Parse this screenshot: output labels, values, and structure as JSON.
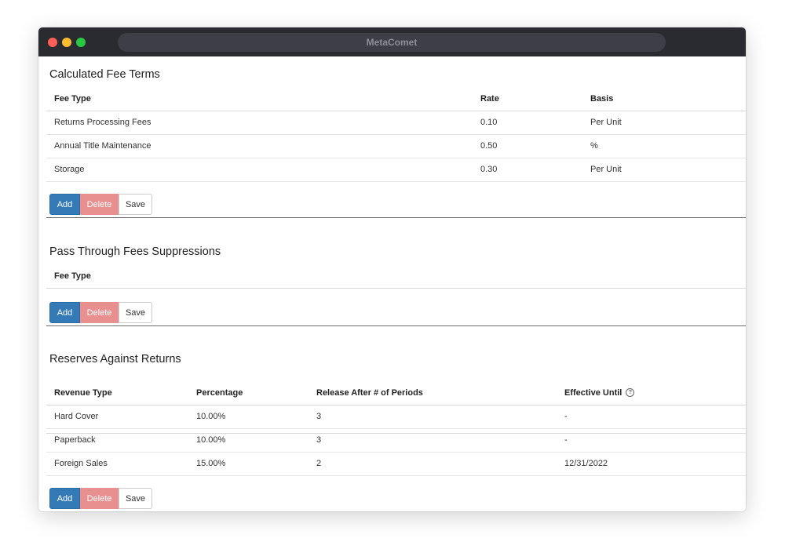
{
  "window": {
    "title": "MetaComet"
  },
  "buttons": {
    "add": "Add",
    "delete": "Delete",
    "save": "Save"
  },
  "calculated_fee_terms": {
    "title": "Calculated Fee Terms",
    "columns": [
      "Fee Type",
      "Rate",
      "Basis"
    ],
    "rows": [
      [
        "Returns Processing Fees",
        "0.10",
        "Per Unit"
      ],
      [
        "Annual Title Maintenance",
        "0.50",
        "%"
      ],
      [
        "Storage",
        "0.30",
        "Per Unit"
      ]
    ]
  },
  "pass_through": {
    "title": "Pass Through Fees Suppressions",
    "columns": [
      "Fee Type"
    ]
  },
  "reserves": {
    "title": "Reserves Against Returns",
    "columns": [
      "Revenue Type",
      "Percentage",
      "Release After # of Periods",
      "Effective Until"
    ],
    "help_icon": "?",
    "rows": [
      [
        "Hard Cover",
        "10.00%",
        "3",
        "-"
      ],
      [
        "Paperback",
        "10.00%",
        "3",
        "-"
      ],
      [
        "Foreign Sales",
        "15.00%",
        "2",
        "12/31/2022"
      ]
    ]
  },
  "colors": {
    "primary": "#337ab7",
    "danger": "#e89090",
    "titlebar": "#2a2b31"
  }
}
